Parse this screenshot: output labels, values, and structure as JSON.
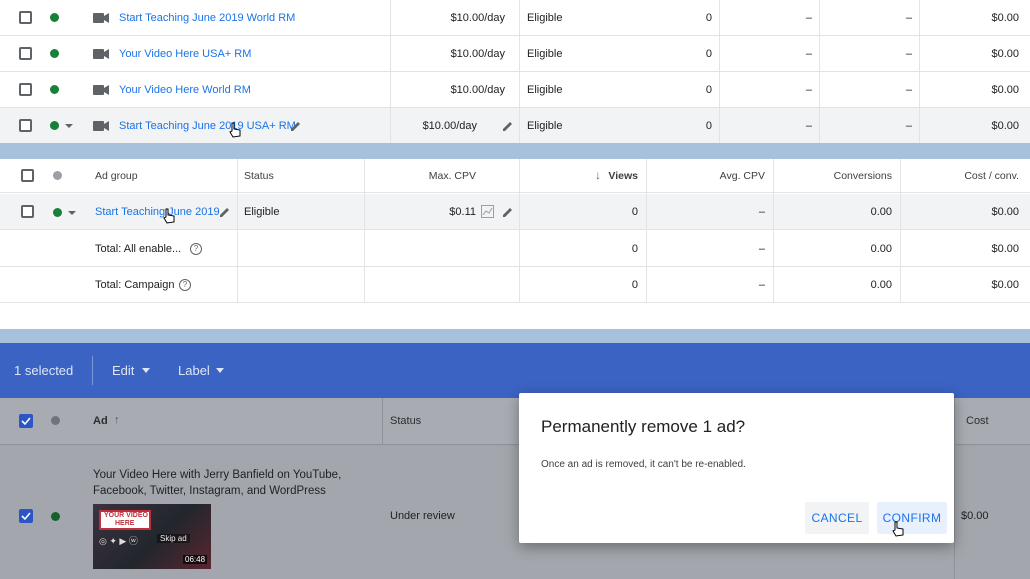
{
  "campaigns": {
    "rows": [
      {
        "name": "Start Teaching June 2019 World RM",
        "budget": "$10.00/day",
        "status": "Eligible",
        "views": "0",
        "col5": "–",
        "col6": "–",
        "cost": "$0.00"
      },
      {
        "name": "Your Video Here USA+ RM",
        "budget": "$10.00/day",
        "status": "Eligible",
        "views": "0",
        "col5": "–",
        "col6": "–",
        "cost": "$0.00"
      },
      {
        "name": "Your Video Here World RM",
        "budget": "$10.00/day",
        "status": "Eligible",
        "views": "0",
        "col5": "–",
        "col6": "–",
        "cost": "$0.00"
      },
      {
        "name": "Start Teaching June 2019 USA+ RM",
        "budget": "$10.00/day",
        "status": "Eligible",
        "views": "0",
        "col5": "–",
        "col6": "–",
        "cost": "$0.00"
      }
    ]
  },
  "adgroups": {
    "headers": {
      "ad_group": "Ad group",
      "status": "Status",
      "max_cpv": "Max. CPV",
      "views": "Views",
      "avg_cpv": "Avg. CPV",
      "conversions": "Conversions",
      "cost_conv": "Cost / conv."
    },
    "row": {
      "name": "Start Teaching June 2019",
      "status": "Eligible",
      "max_cpv": "$0.11",
      "views": "0",
      "avg_cpv": "–",
      "conversions": "0.00",
      "cost_conv": "$0.00"
    },
    "totals": [
      {
        "label": "Total: All enable...",
        "views": "0",
        "avg_cpv": "–",
        "conversions": "0.00",
        "cost_conv": "$0.00"
      },
      {
        "label": "Total: Campaign",
        "views": "0",
        "avg_cpv": "–",
        "conversions": "0.00",
        "cost_conv": "$0.00"
      }
    ]
  },
  "ads": {
    "selection": {
      "count_label": "1 selected",
      "edit_label": "Edit",
      "label_label": "Label"
    },
    "headers": {
      "ad": "Ad",
      "status": "Status",
      "cost": "Cost"
    },
    "row": {
      "title_line1": "Your Video Here with Jerry Banfield on YouTube,",
      "title_line2": "Facebook, Twitter, Instagram, and WordPress",
      "thumb_text1": "YOUR VIDEO",
      "thumb_text2": "HERE",
      "skip_label": "Skip ad",
      "duration": "06:48",
      "status": "Under review",
      "cost": "$0.00"
    }
  },
  "dialog": {
    "title": "Permanently remove 1 ad?",
    "body": "Once an ad is removed, it can't be re-enabled.",
    "cancel_label": "CANCEL",
    "confirm_label": "CONFIRM"
  },
  "colors": {
    "accent": "#1a73e8",
    "enabled": "#188038",
    "selection_bar": "#3b63c4",
    "separator": "#a7c0dc"
  }
}
